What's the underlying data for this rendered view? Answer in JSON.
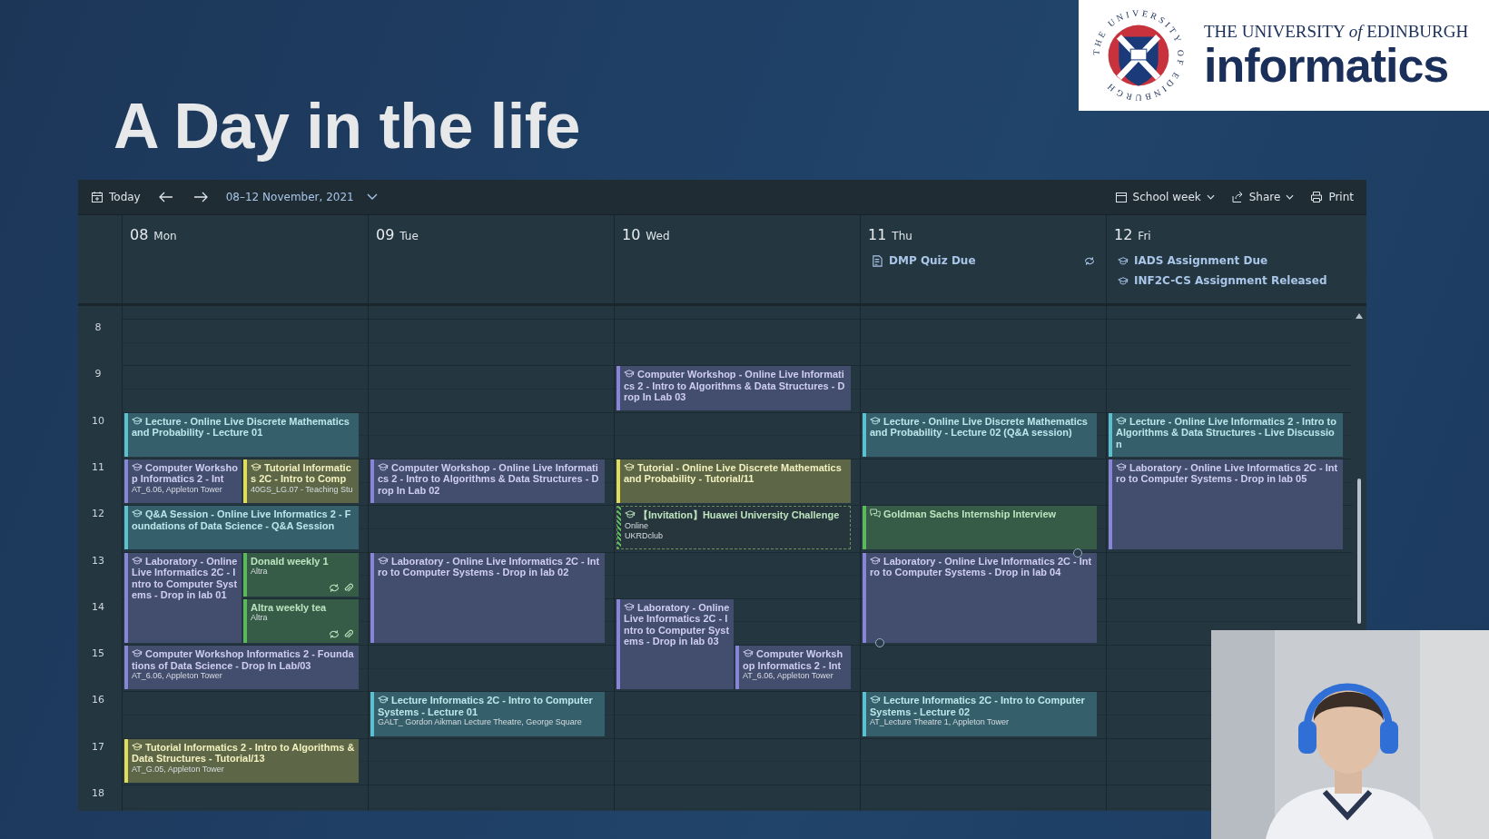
{
  "slide": {
    "title": "A Day in the life",
    "logo": {
      "crest_text": "THE UNIVERSITY OF EDINBURGH",
      "line": "THE UNIVERSITY *of* EDINBURGH",
      "wordmark": "informatics"
    }
  },
  "toolbar": {
    "today": "Today",
    "range": "08–12 November, 2021",
    "view": "School week",
    "share": "Share",
    "print": "Print"
  },
  "hours": [
    "8",
    "9",
    "10",
    "11",
    "12",
    "13",
    "14",
    "15",
    "16",
    "17",
    "18"
  ],
  "days": [
    {
      "number": "08",
      "name": "Mon",
      "events": [
        {
          "kind": "class",
          "title": "Lecture - Online Live Discrete Mathematics and Probability - Lecture 01",
          "color": "#5bc0d0",
          "recurring": false,
          "attachment": false,
          "tentative": false,
          "selected": false
        },
        {
          "kind": "class",
          "title": "Computer Workshop Informatics 2 - Int",
          "details": [
            "AT_6.06, Appleton Tower"
          ],
          "color": "#8884d8",
          "recurring": false,
          "attachment": false,
          "tentative": false,
          "selected": false
        },
        {
          "kind": "class",
          "title": "Tutorial Informatics 2C - Intro to Comp",
          "details": [
            "40GS_LG.07 - Teaching Stu"
          ],
          "color": "#e0dc5c",
          "recurring": false,
          "attachment": false,
          "tentative": false,
          "selected": false
        },
        {
          "kind": "class",
          "title": "Q&A Session - Online Live Informatics 2 - Foundations of Data Science - Q&A Session",
          "color": "#5bc0d0",
          "recurring": false,
          "attachment": false,
          "tentative": false,
          "selected": false
        },
        {
          "kind": "class",
          "title": "Laboratory - Online Live Informatics 2C - Intro to Computer Systems - Drop in lab 01",
          "color": "#8884d8",
          "recurring": false,
          "attachment": false,
          "tentative": false,
          "selected": false
        },
        {
          "kind": "personal",
          "title": "Donald weekly 1",
          "details": [
            "Altra"
          ],
          "color": "#5cb85c",
          "recurring": true,
          "attachment": true,
          "tentative": false,
          "selected": false
        },
        {
          "kind": "personal",
          "title": "Altra weekly tea",
          "details": [
            "Altra"
          ],
          "color": "#5cb85c",
          "recurring": true,
          "attachment": true,
          "tentative": false,
          "selected": false
        },
        {
          "kind": "class",
          "title": "Computer Workshop Informatics 2 - Foundations of Data Science - Drop In Lab/03",
          "details": [
            "AT_6.06, Appleton Tower"
          ],
          "color": "#8884d8",
          "recurring": false,
          "attachment": false,
          "tentative": false,
          "selected": false
        },
        {
          "kind": "class",
          "title": "Tutorial Informatics 2 - Intro to Algorithms & Data Structures - Tutorial/13",
          "details": [
            "AT_G.05, Appleton Tower"
          ],
          "color": "#e0dc5c",
          "recurring": false,
          "attachment": false,
          "tentative": false,
          "selected": false
        }
      ]
    },
    {
      "number": "09",
      "name": "Tue",
      "events": [
        {
          "kind": "class",
          "title": "Computer Workshop - Online Live Informatics 2 - Intro to Algorithms & Data Structures - Drop In Lab 02",
          "color": "#8884d8",
          "recurring": false,
          "attachment": false,
          "tentative": false,
          "selected": false
        },
        {
          "kind": "class",
          "title": "Laboratory - Online Live Informatics 2C - Intro to Computer Systems - Drop in lab 02",
          "color": "#8884d8",
          "recurring": false,
          "attachment": false,
          "tentative": false,
          "selected": false
        },
        {
          "kind": "class",
          "title": "Lecture Informatics 2C - Intro to Computer Systems - Lecture 01",
          "details": [
            "GALT_ Gordon Aikman Lecture Theatre, George Square"
          ],
          "color": "#5bc0d0",
          "recurring": false,
          "attachment": false,
          "tentative": false,
          "selected": false
        }
      ]
    },
    {
      "number": "10",
      "name": "Wed",
      "events": [
        {
          "kind": "class",
          "title": "Computer Workshop - Online Live Informatics 2 - Intro to Algorithms & Data Structures - Drop In Lab 03",
          "color": "#8884d8",
          "recurring": false,
          "attachment": false,
          "tentative": false,
          "selected": false
        },
        {
          "kind": "class",
          "title": "Tutorial - Online Live Discrete Mathematics and Probability - Tutorial/11",
          "color": "#e0dc5c",
          "recurring": false,
          "attachment": false,
          "tentative": false,
          "selected": false
        },
        {
          "kind": "class",
          "title": "【Invitation】Huawei University Challenge",
          "details": [
            "Online",
            "UKRDclub"
          ],
          "color": "#5cb85c",
          "recurring": false,
          "attachment": false,
          "tentative": true,
          "selected": false
        },
        {
          "kind": "class",
          "title": "Laboratory - Online Live Informatics 2C - Intro to Computer Systems - Drop in lab 03",
          "color": "#8884d8",
          "recurring": false,
          "attachment": false,
          "tentative": false,
          "selected": false
        },
        {
          "kind": "class",
          "title": "Computer Workshop Informatics 2 - Int",
          "details": [
            "AT_6.06, Appleton Tower"
          ],
          "color": "#8884d8",
          "recurring": false,
          "attachment": false,
          "tentative": false,
          "selected": false
        }
      ]
    },
    {
      "number": "11",
      "name": "Thu",
      "all_day": [
        {
          "kind": "task",
          "title": "DMP Quiz Due",
          "recurring": true
        }
      ],
      "events": [
        {
          "kind": "class",
          "title": "Lecture - Online Live Discrete Mathematics and Probability - Lecture 02 (Q&A session)",
          "color": "#5bc0d0",
          "recurring": false,
          "attachment": false,
          "tentative": false,
          "selected": false
        },
        {
          "kind": "meeting",
          "title": "Goldman Sachs Internship Interview",
          "color": "#5cb85c",
          "recurring": false,
          "attachment": false,
          "tentative": false,
          "selected": false
        },
        {
          "kind": "class",
          "title": "Laboratory - Online Live Informatics 2C - Intro to Computer Systems - Drop in lab 04",
          "color": "#8884d8",
          "recurring": false,
          "attachment": false,
          "tentative": false,
          "selected": true
        },
        {
          "kind": "class",
          "title": "Lecture Informatics 2C - Intro to Computer Systems - Lecture 02",
          "details": [
            "AT_Lecture Theatre 1, Appleton Tower"
          ],
          "color": "#5bc0d0",
          "recurring": false,
          "attachment": false,
          "tentative": false,
          "selected": false
        }
      ]
    },
    {
      "number": "12",
      "name": "Fri",
      "all_day": [
        {
          "kind": "class",
          "title": "IADS Assignment Due",
          "recurring": false
        },
        {
          "kind": "class",
          "title": "INF2C-CS Assignment Released",
          "recurring": false
        }
      ],
      "events": [
        {
          "kind": "class",
          "title": "Lecture - Online Live Informatics 2 - Intro to Algorithms & Data Structures - Live Discussion",
          "color": "#5bc0d0",
          "recurring": false,
          "attachment": false,
          "tentative": false,
          "selected": false
        },
        {
          "kind": "class",
          "title": "Laboratory - Online Live Informatics 2C - Intro to Computer Systems - Drop in lab 05",
          "color": "#8884d8",
          "recurring": false,
          "attachment": false,
          "tentative": false,
          "selected": false
        }
      ]
    }
  ]
}
